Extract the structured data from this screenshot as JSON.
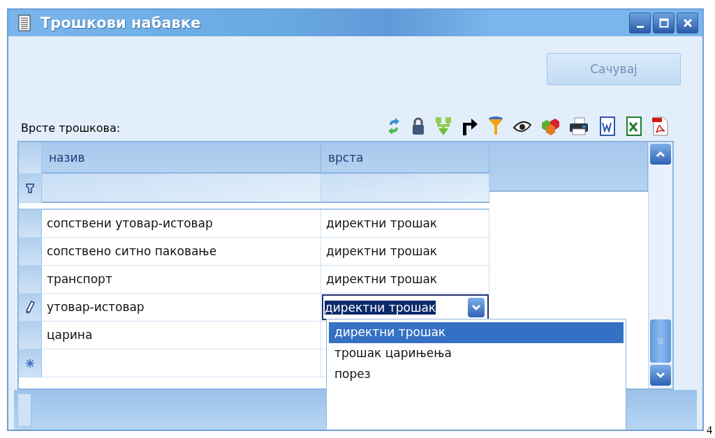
{
  "window": {
    "title": "Трошкови набавке"
  },
  "save_button": {
    "label": "Сачувај",
    "disabled": true
  },
  "grid_label": "Врсте трошкова:",
  "table": {
    "columns": [
      "назив",
      "врста"
    ],
    "rows": [
      {
        "name": "сопствени утовар-истовар",
        "type": "директни трошак",
        "editing": false
      },
      {
        "name": "сопствено ситно паковање",
        "type": "директни трошак",
        "editing": false
      },
      {
        "name": "транспорт",
        "type": "директни трошак",
        "editing": false
      },
      {
        "name": "утовар-истовар",
        "type": "директни трошак",
        "editing": true
      },
      {
        "name": "царина",
        "type": "",
        "editing": false
      }
    ]
  },
  "dropdown": {
    "items": [
      {
        "label": "директни трошак",
        "selected": true
      },
      {
        "label": "трошак царињења",
        "selected": false
      },
      {
        "label": "порез",
        "selected": false
      }
    ]
  },
  "page_number": "4"
}
